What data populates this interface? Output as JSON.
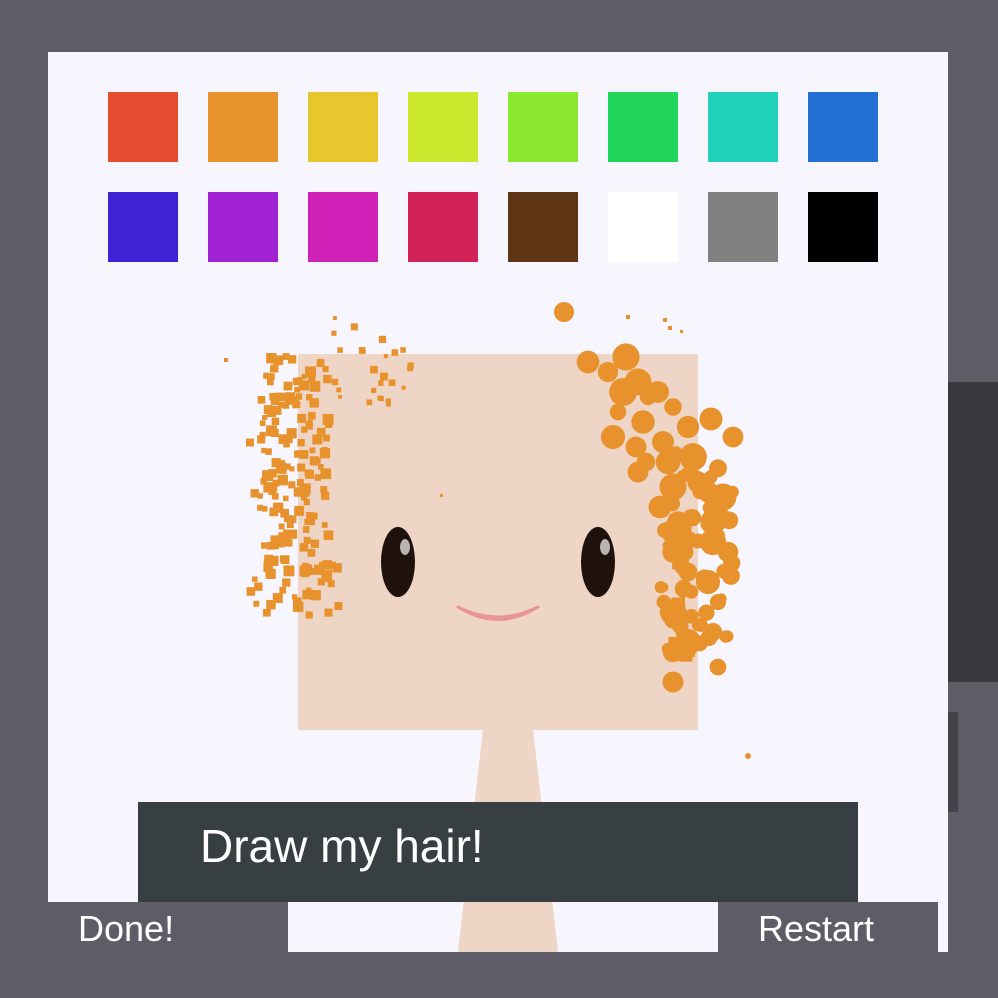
{
  "palette": {
    "colors": [
      "#e84c30",
      "#e8922e",
      "#e8c62e",
      "#cce82e",
      "#8ae82e",
      "#21d45a",
      "#22d1bb",
      "#2270d4",
      "#3e22d4",
      "#a022d4",
      "#d022b8",
      "#d22258",
      "#5e3616",
      "#ffffff",
      "#808080",
      "#000000"
    ]
  },
  "drawing": {
    "hair_color": "#e8922e",
    "skin_color": "#efd5c5",
    "eye_color": "#1f110c",
    "mouth_color": "#e8949a"
  },
  "prompt": {
    "text": "Draw my hair!"
  },
  "buttons": {
    "done_label": "Done!",
    "restart_label": "Restart"
  }
}
